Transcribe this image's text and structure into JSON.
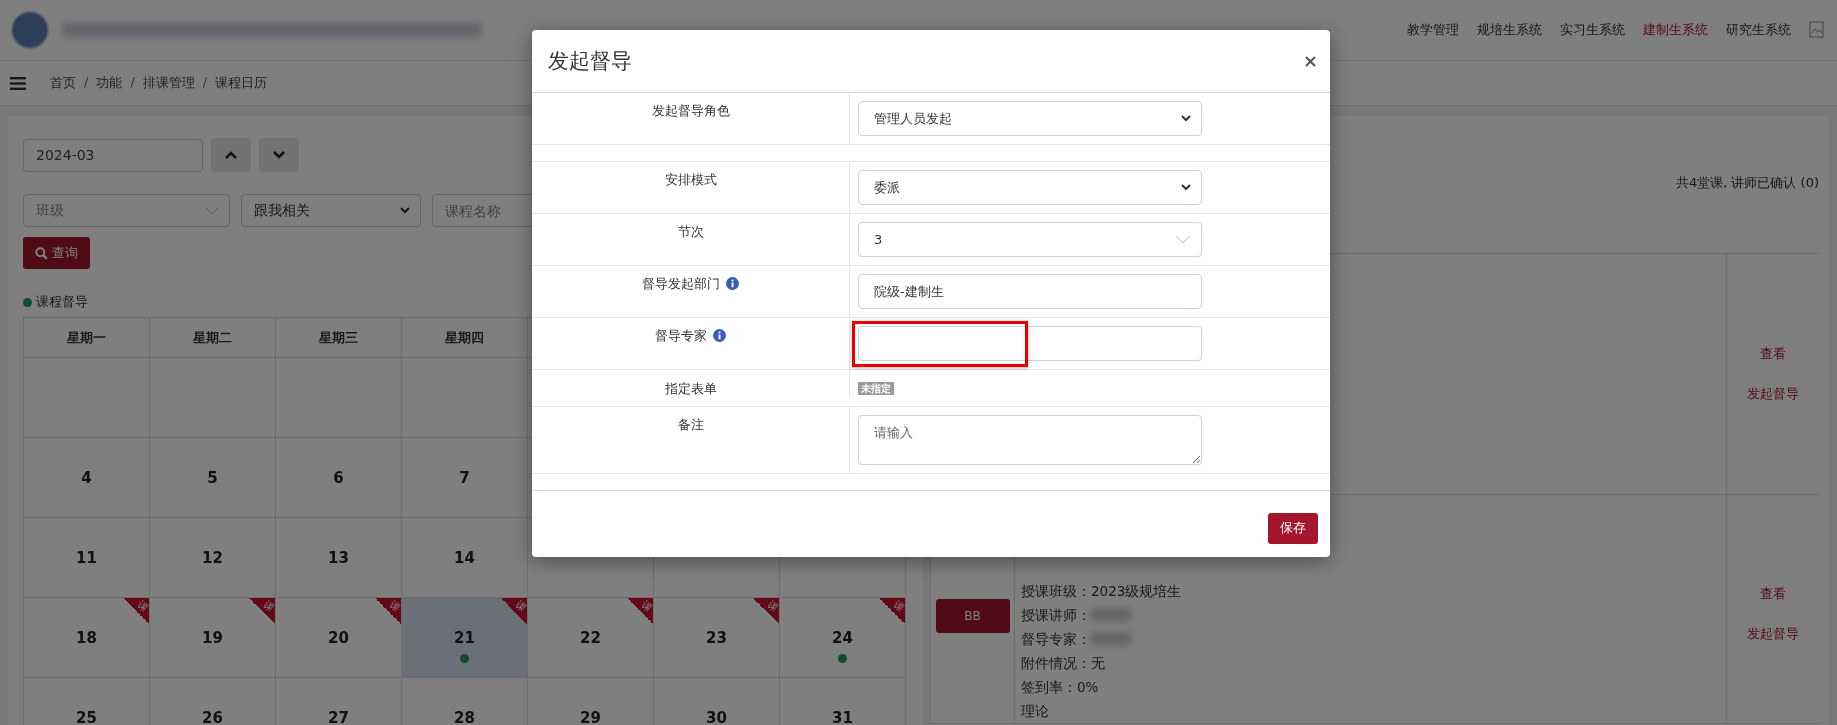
{
  "header": {
    "nav": [
      {
        "label": "教学管理",
        "selected": false
      },
      {
        "label": "规培生系统",
        "selected": false
      },
      {
        "label": "实习生系统",
        "selected": false
      },
      {
        "label": "建制生系统",
        "selected": true
      },
      {
        "label": "研究生系统",
        "selected": false
      }
    ]
  },
  "breadcrumb": [
    {
      "label": "首页"
    },
    {
      "separator": "/",
      "label": "功能"
    },
    {
      "separator": "/",
      "label": "排课管理"
    },
    {
      "separator": "/",
      "label": "课程日历"
    }
  ],
  "filters": {
    "month": "2024-03",
    "class_placeholder": "班级",
    "relation": "跟我相关",
    "course_placeholder": "课程名称",
    "search_button": "查询"
  },
  "legend": "课程督导",
  "calendar": {
    "weekdays": [
      "星期一",
      "星期二",
      "星期三",
      "星期四"
    ],
    "weeks": [
      [
        {
          "selected": false,
          "supervised": false
        },
        {
          "selected": false,
          "supervised": false
        },
        {
          "selected": false,
          "supervised": false
        },
        {
          "selected": false,
          "supervised": false
        }
      ],
      [
        {
          "day": "4",
          "selected": false,
          "supervised": false
        },
        {
          "day": "5",
          "selected": false,
          "supervised": false
        },
        {
          "day": "6",
          "selected": false,
          "supervised": false
        },
        {
          "day": "7",
          "selected": false,
          "supervised": false
        }
      ],
      [
        {
          "day": "11",
          "selected": false,
          "supervised": false
        },
        {
          "day": "12",
          "selected": false,
          "supervised": false
        },
        {
          "day": "13",
          "selected": false,
          "supervised": false
        },
        {
          "day": "14",
          "selected": false,
          "supervised": false
        }
      ],
      [
        {
          "day": "18",
          "badge": "课",
          "selected": false,
          "supervised": false
        },
        {
          "day": "19",
          "badge": "课",
          "selected": false,
          "supervised": false
        },
        {
          "day": "20",
          "badge": "课",
          "selected": false,
          "supervised": false
        },
        {
          "day": "21",
          "badge": "课",
          "selected": true,
          "supervised": true
        },
        {
          "day": "22",
          "badge": "课",
          "selected": false,
          "supervised": false
        },
        {
          "day": "23",
          "badge": "课",
          "selected": false,
          "supervised": false
        },
        {
          "day": "24",
          "badge": "课",
          "selected": false,
          "supervised": true
        }
      ],
      [
        {
          "day": "25",
          "selected": false
        },
        {
          "day": "26",
          "selected": false
        },
        {
          "day": "27",
          "selected": false
        },
        {
          "day": "28",
          "selected": false
        },
        {
          "day": "29",
          "selected": false
        },
        {
          "day": "30",
          "selected": false
        },
        {
          "day": "31",
          "selected": false
        }
      ]
    ]
  },
  "summary": "共4堂课, 讲师已确认 (0)",
  "courses": [
    {
      "actions": [
        "查看",
        "发起督导"
      ]
    },
    {
      "tag": "BB",
      "details": [
        {
          "text": "授课班级：2023级规培生",
          "redacted": false
        },
        {
          "text": "授课讲师：",
          "redacted": true
        },
        {
          "text": "督导专家：",
          "redacted": true
        },
        {
          "text": "附件情况：无",
          "redacted": false
        },
        {
          "text": "签到率：0%",
          "redacted": false
        },
        {
          "text": "理论",
          "redacted": false
        }
      ],
      "actions": [
        "查看",
        "发起督导"
      ]
    }
  ],
  "modal": {
    "title": "发起督导",
    "fields": [
      {
        "kind": "select",
        "label": "发起督导角色",
        "value": "管理人员发起"
      },
      {
        "kind": "spacer"
      },
      {
        "kind": "select",
        "label": "安排模式",
        "value": "委派"
      },
      {
        "kind": "combo",
        "label": "节次",
        "value": "3"
      },
      {
        "kind": "input",
        "label": "督导发起部门",
        "info": true,
        "value": "院级-建制生",
        "highlighted": false
      },
      {
        "kind": "input",
        "label": "督导专家",
        "info": true,
        "highlighted": true
      },
      {
        "kind": "tag",
        "label": "指定表单",
        "value": "未指定"
      },
      {
        "kind": "textarea",
        "label": "备注",
        "placeholder": "请输入"
      }
    ],
    "save": "保存"
  }
}
